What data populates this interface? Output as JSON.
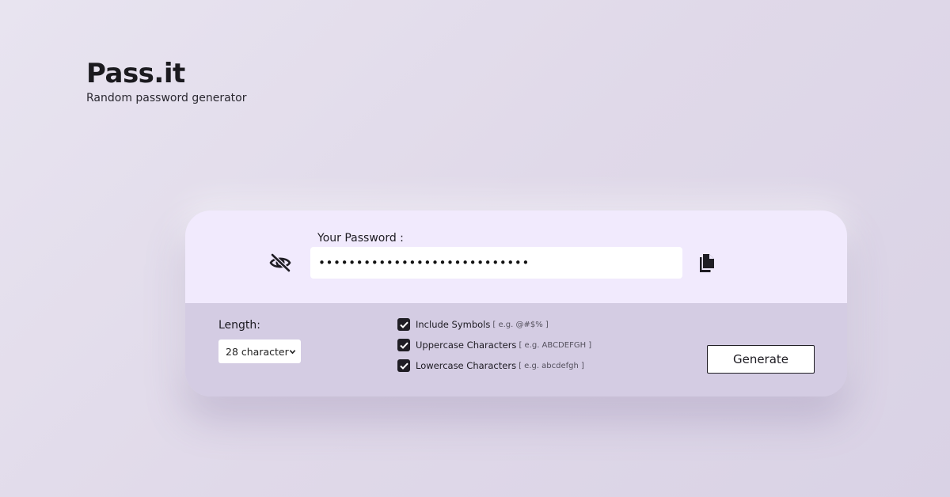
{
  "brand": {
    "title": "Pass.it",
    "subtitle": "Random password generator"
  },
  "password": {
    "label": "Your Password :",
    "masked_value": "••••••••••••••••••••••••••••",
    "visibility_icon": "eye-slash-icon",
    "copy_icon": "copy-icon"
  },
  "length": {
    "label": "Length:",
    "selected": "28 character"
  },
  "options": [
    {
      "label": "Include Symbols",
      "example": "[ e.g. @#$% ]",
      "checked": true
    },
    {
      "label": "Uppercase Characters",
      "example": "[ e.g. ABCDEFGH ]",
      "checked": true
    },
    {
      "label": "Lowercase Characters",
      "example": "[ e.g. abcdefgh ]",
      "checked": true
    }
  ],
  "actions": {
    "generate_label": "Generate"
  },
  "colors": {
    "card_top": "#f1eafd",
    "card_bottom": "#d4cce3",
    "checkbox": "#1f1d24"
  }
}
